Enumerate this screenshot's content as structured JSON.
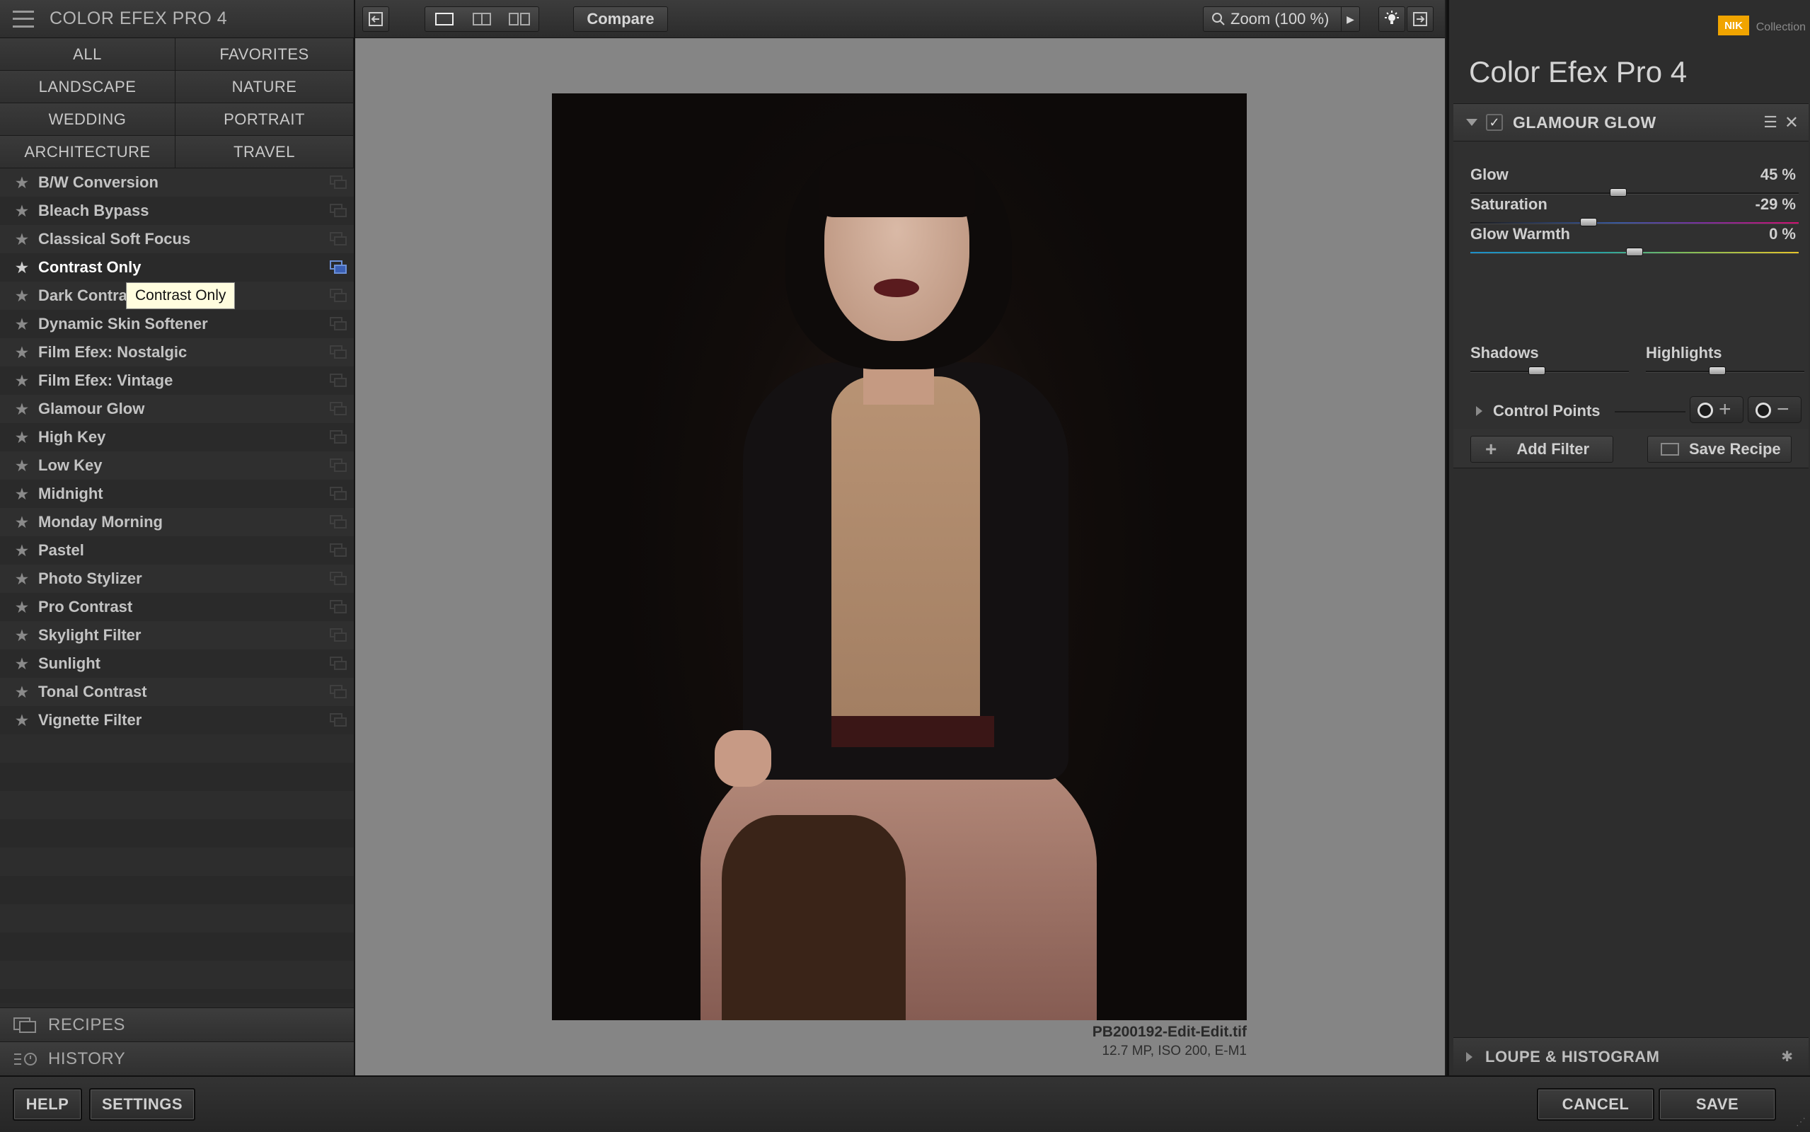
{
  "app": {
    "title": "COLOR EFEX PRO 4",
    "brand_logo": "NIK",
    "brand_text": "Collection",
    "panel_title": "Color Efex Pro 4"
  },
  "categories": [
    "ALL",
    "FAVORITES",
    "LANDSCAPE",
    "NATURE",
    "WEDDING",
    "PORTRAIT",
    "ARCHITECTURE",
    "TRAVEL"
  ],
  "filters": [
    "B/W Conversion",
    "Bleach Bypass",
    "Classical Soft Focus",
    "Contrast Only",
    "Dark Contrasts",
    "Dynamic Skin Softener",
    "Film Efex: Nostalgic",
    "Film Efex: Vintage",
    "Glamour Glow",
    "High Key",
    "Low Key",
    "Midnight",
    "Monday Morning",
    "Pastel",
    "Photo Stylizer",
    "Pro Contrast",
    "Skylight Filter",
    "Sunlight",
    "Tonal Contrast",
    "Vignette Filter"
  ],
  "active_filter_index": 3,
  "tooltip": "Contrast Only",
  "left_tabs": {
    "recipes": "RECIPES",
    "history": "HISTORY"
  },
  "toolbar": {
    "compare": "Compare",
    "zoom": "Zoom (100 %)"
  },
  "image": {
    "filename": "PB200192-Edit-Edit.tif",
    "meta": "12.7 MP, ISO 200, E-M1"
  },
  "filter_panel": {
    "name": "GLAMOUR GLOW",
    "enabled": true,
    "sliders": [
      {
        "label": "Glow",
        "value": "45 %",
        "level": 0.45
      },
      {
        "label": "Saturation",
        "value": "-29 %",
        "level": 0.36
      },
      {
        "label": "Glow Warmth",
        "value": "0 %",
        "level": 0.5
      }
    ],
    "shadows": {
      "label": "Shadows",
      "level": 0.42
    },
    "highlights": {
      "label": "Highlights",
      "level": 0.45
    },
    "control_points": "Control Points"
  },
  "actions": {
    "add_filter": "Add Filter",
    "save_recipe": "Save Recipe"
  },
  "loupe": "LOUPE & HISTOGRAM",
  "bottom": {
    "help": "HELP",
    "settings": "SETTINGS",
    "cancel": "CANCEL",
    "save": "SAVE"
  },
  "icons": {
    "menu": "hamburger-icon",
    "star": "star-icon",
    "copy": "duplicate-icon",
    "zoom": "magnifier-icon",
    "bulb": "light-bulb-icon",
    "exit": "exit-icon"
  },
  "colors": {
    "accent": "#f0a400",
    "active_copy": "#3a5fb4",
    "tooltip_bg": "#fffddf"
  }
}
